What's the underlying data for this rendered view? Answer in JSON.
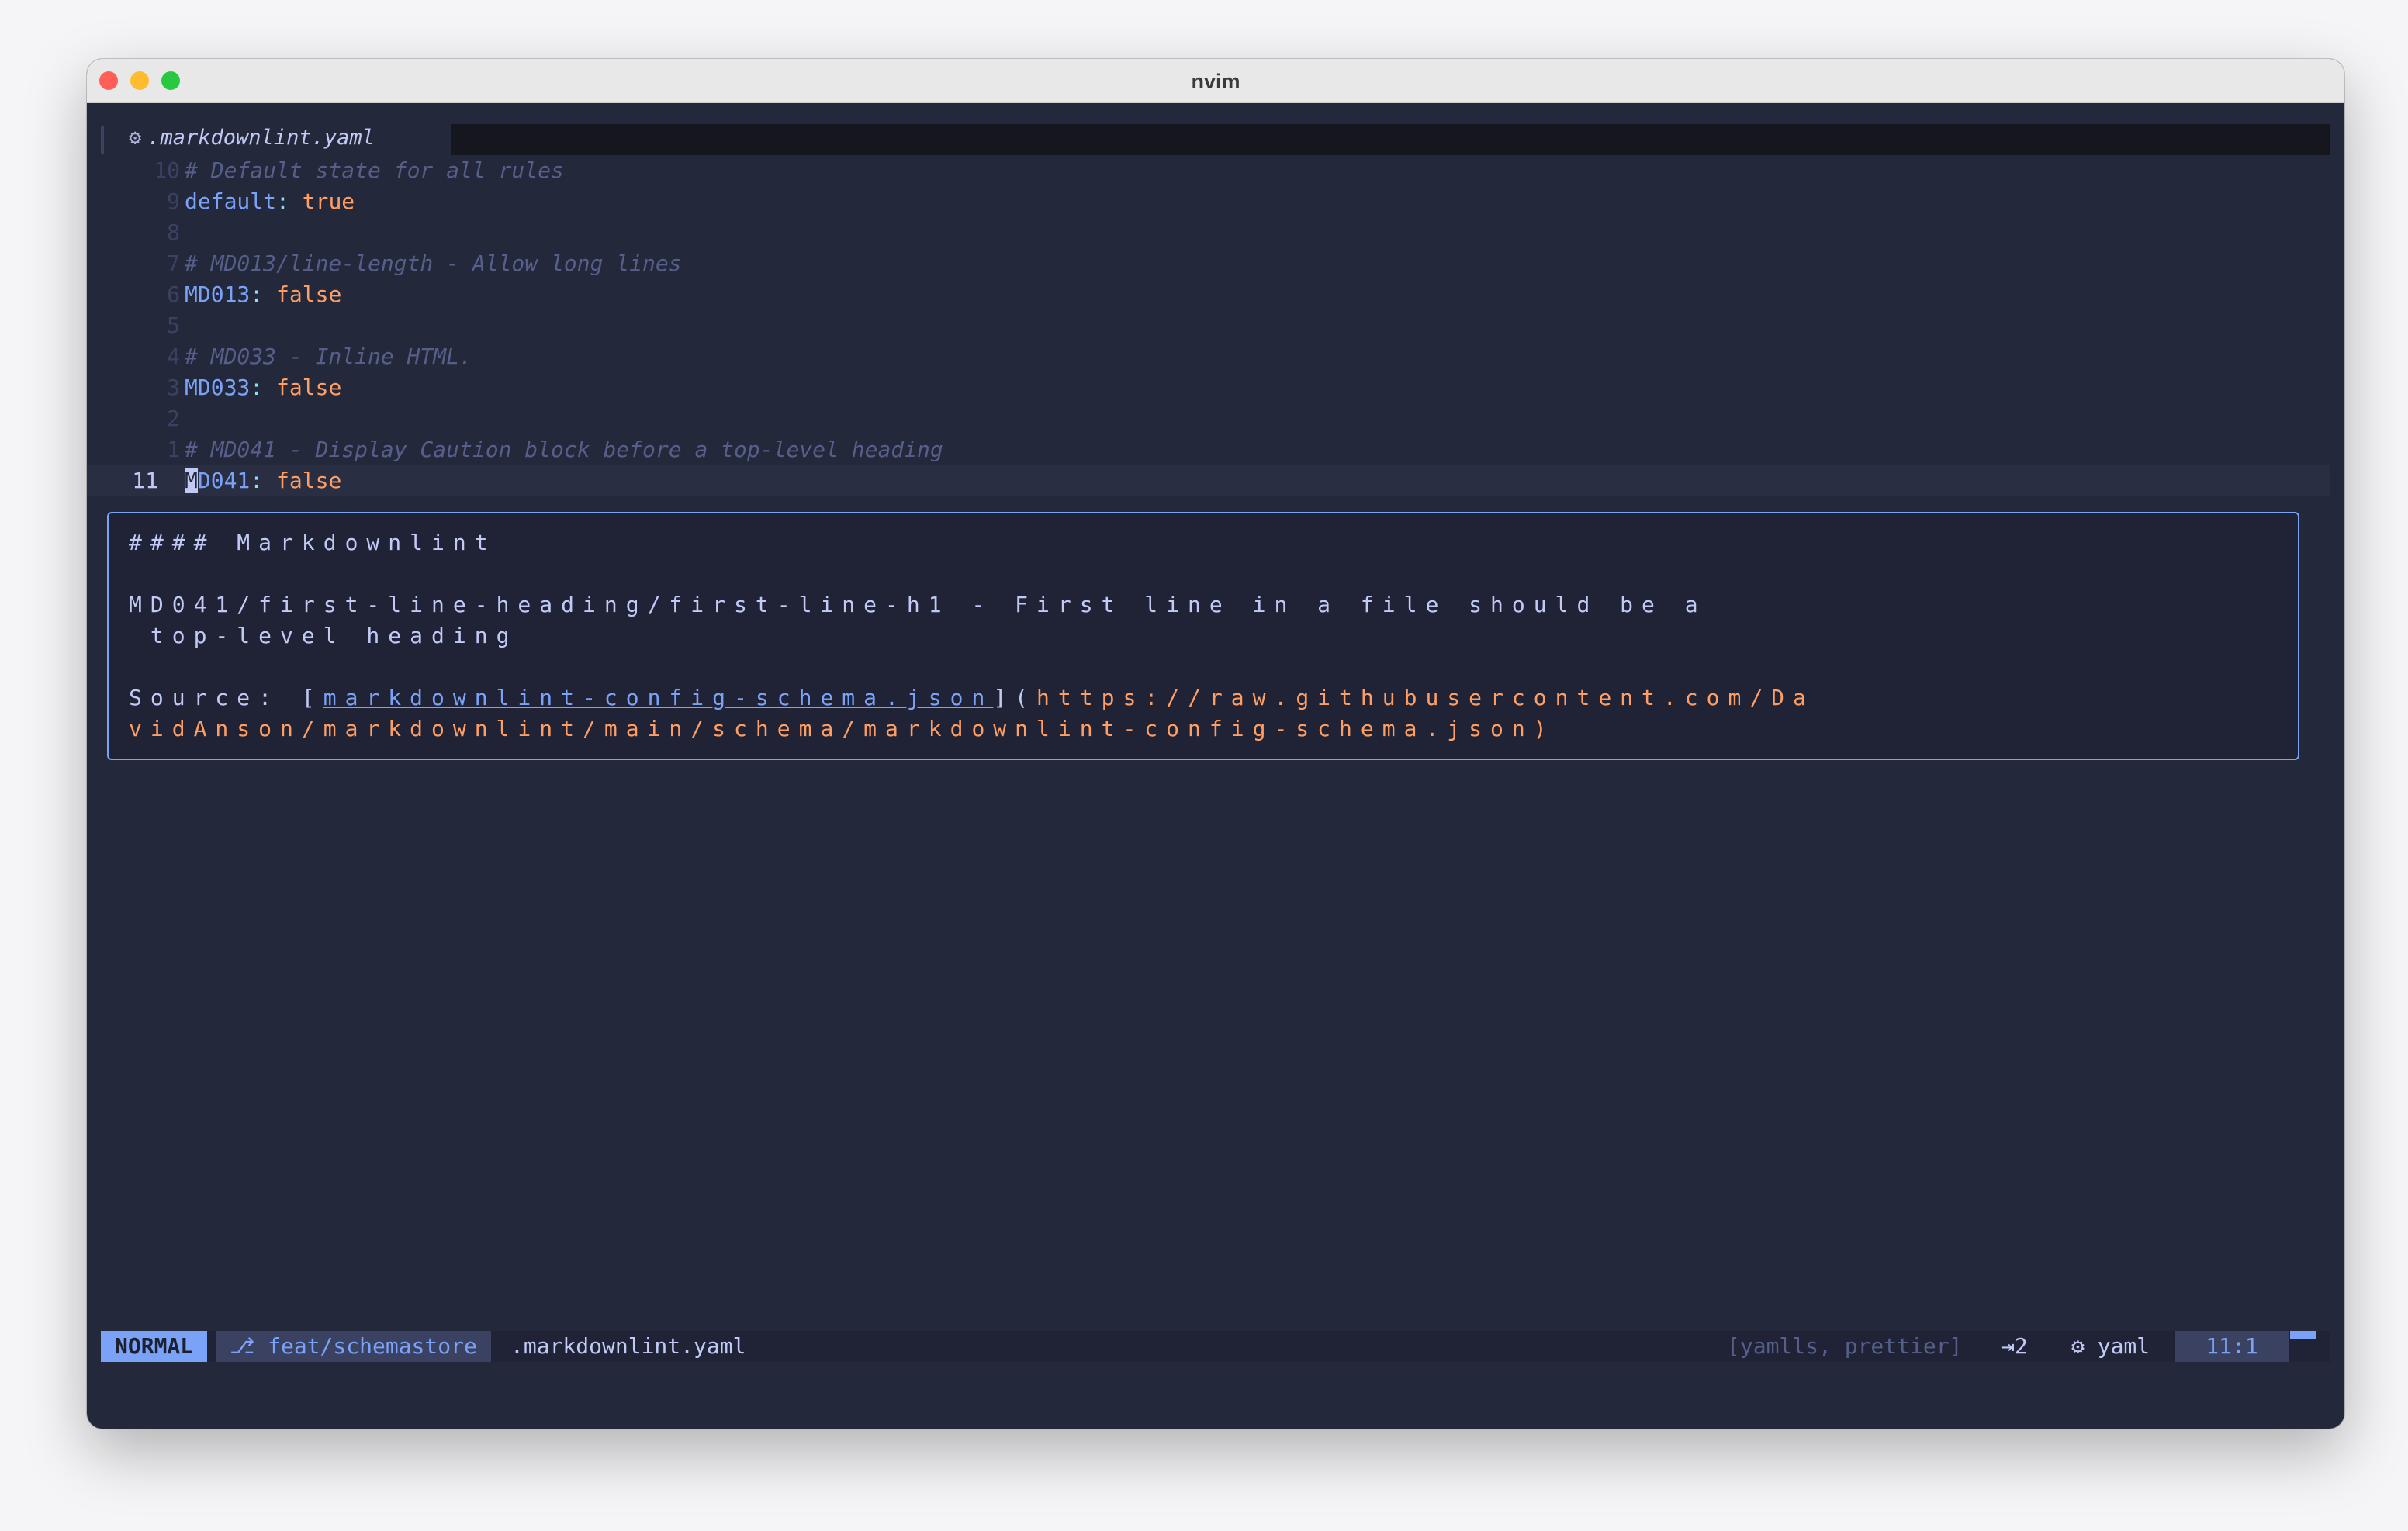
{
  "window": {
    "title": "nvim"
  },
  "winbar": {
    "icon": "gear-icon",
    "filename": ".markdownlint.yaml"
  },
  "code_lines": [
    {
      "num": "10",
      "comment": "# Default state for all rules"
    },
    {
      "num": "9",
      "key": "default",
      "colon": ":",
      "value": "true"
    },
    {
      "num": "8"
    },
    {
      "num": "7",
      "comment": "# MD013/line-length - Allow long lines"
    },
    {
      "num": "6",
      "key": "MD013",
      "colon": ":",
      "value": "false"
    },
    {
      "num": "5"
    },
    {
      "num": "4",
      "comment": "# MD033 - Inline HTML."
    },
    {
      "num": "3",
      "key": "MD033",
      "colon": ":",
      "value": "false"
    },
    {
      "num": "2"
    },
    {
      "num": "1",
      "comment": "# MD041 - Display Caution block before a top-level heading"
    },
    {
      "num": "11",
      "cursor_char": "M",
      "key_rest": "D041",
      "colon": ":",
      "value": "false"
    }
  ],
  "hover": {
    "heading": "#### Markdownlint",
    "desc_line1": "MD041/first-line-heading/first-line-h1 - First line in a file should be a",
    "desc_line2": " top-level heading",
    "source_prefix": "Source: [",
    "source_link": "markdownlint-config-schema.json",
    "source_mid": "](",
    "source_url_line1": "https://raw.githubusercontent.com/Da",
    "source_url_line2": "vidAnson/markdownlint/main/schema/markdownlint-config-schema.json",
    "source_suffix": ")"
  },
  "statusline": {
    "mode": "NORMAL",
    "branch_icon": "git-branch-icon",
    "branch": "feat/schemastore",
    "filename": ".markdownlint.yaml",
    "lsp": "[yamlls, prettier]",
    "indent_icon": "tab-icon",
    "indent": "2",
    "filetype_icon": "gear-icon",
    "filetype": "yaml",
    "position": "11:1"
  }
}
